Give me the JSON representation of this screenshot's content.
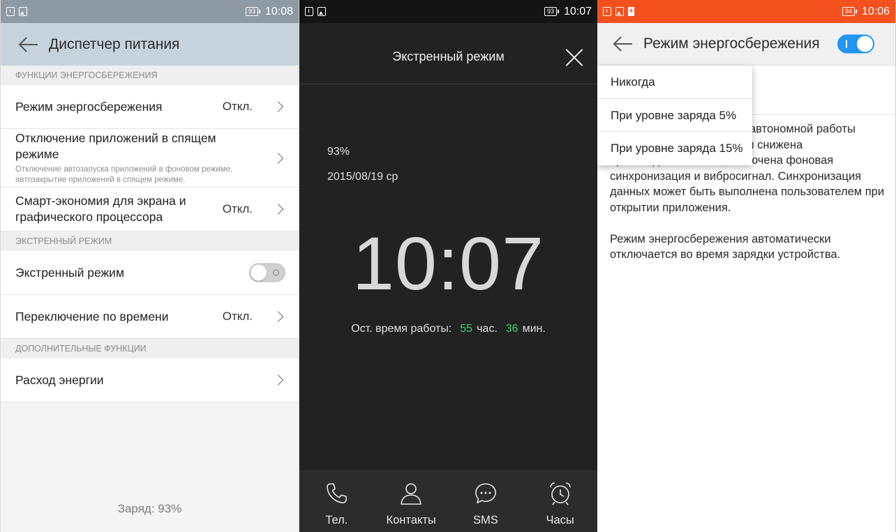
{
  "screen1": {
    "status": {
      "battery": "93",
      "time": "10:08"
    },
    "title": "Диспетчер питания",
    "sections": [
      {
        "header": "ФУНКЦИИ ЭНЕРГОСБЕРЕЖЕНИЯ"
      },
      {
        "header": "ЭКСТРЕННЫЙ РЕЖИМ"
      },
      {
        "header": "ДОПОЛНИТЕЛЬНЫЕ ФУНКЦИИ"
      }
    ],
    "rows": {
      "power_saving": {
        "title": "Режим энергосбережения",
        "value": "Откл."
      },
      "sleep_apps": {
        "title": "Отключение приложений в спящем режиме",
        "subtitle": "Отключение автозапуска приложений в фоновом режиме, автозакрытие приложений в спящем режиме."
      },
      "smart_economy": {
        "title": "Смарт-экономия для экрана и графического процессора",
        "value": "Откл."
      },
      "emergency": {
        "title": "Экстренный режим",
        "toggle": false
      },
      "schedule": {
        "title": "Переключение по времени",
        "value": "Откл."
      },
      "consumption": {
        "title": "Расход энергии"
      }
    },
    "footer": "Заряд: 93%"
  },
  "screen2": {
    "status": {
      "battery": "93",
      "time": "10:07"
    },
    "title": "Экстренный режим",
    "battery": "93%",
    "date": "2015/08/19  ср",
    "clock": "10:07",
    "remaining": {
      "label": "Ост. время работы:",
      "hours": "55",
      "hours_unit": "час.",
      "minutes": "36",
      "minutes_unit": "мин."
    },
    "dock": [
      {
        "label": "Тел.",
        "icon": "phone-icon"
      },
      {
        "label": "Контакты",
        "icon": "contact-icon"
      },
      {
        "label": "SMS",
        "icon": "sms-icon"
      },
      {
        "label": "Часы",
        "icon": "alarm-clock-icon"
      }
    ]
  },
  "screen3": {
    "status": {
      "battery": "94",
      "time": "10:06"
    },
    "title": "Режим энергосбережения",
    "toggle_on": true,
    "dropdown": [
      "Никогда",
      "При уровне заряда 5%",
      "При уровне заряда 15%"
    ],
    "description": [
      "автономной работы режиме энергосбережения снижена производительность, отключена фоновая синхронизация и вибросигнал.  Синхронизация данных может быть выполнена пользователем при открытии приложения.",
      "Режим энергосбережения автоматически отключается во время зарядки устройства."
    ]
  },
  "colors": {
    "accent": "#2196f3",
    "green": "#3dd46a",
    "status_orange": "#f4511e"
  }
}
